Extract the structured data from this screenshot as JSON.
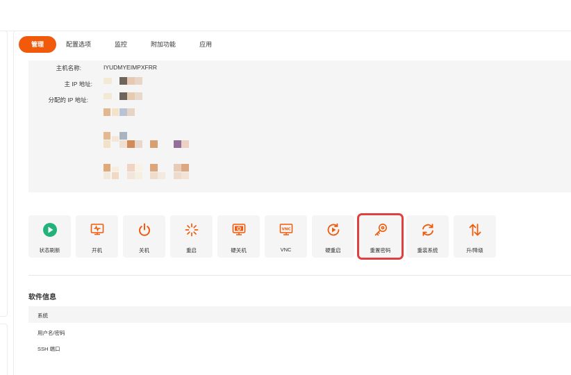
{
  "tabs": [
    {
      "label": "管理",
      "active": true
    },
    {
      "label": "配置选项"
    },
    {
      "label": "监控"
    },
    {
      "label": "附加功能"
    },
    {
      "label": "应用"
    }
  ],
  "info": {
    "hostname_label": "主机名称:",
    "hostname_value": "IYUDMYEIMPXFRR",
    "main_ip_label": "主 IP 地址:",
    "assigned_ip_label": "分配的 IP 地址:"
  },
  "actions": [
    {
      "label": "状态刷新",
      "icon": "play-circle-icon",
      "color": "#23b37a"
    },
    {
      "label": "开机",
      "icon": "power-on-monitor-icon",
      "color": "#f15a0a"
    },
    {
      "label": "关机",
      "icon": "power-icon",
      "color": "#f15a0a"
    },
    {
      "label": "重启",
      "icon": "spinner-icon",
      "color": "#f15a0a"
    },
    {
      "label": "硬关机",
      "icon": "hard-shutdown-icon",
      "color": "#f15a0a"
    },
    {
      "label": "VNC",
      "icon": "vnc-monitor-icon",
      "color": "#f15a0a"
    },
    {
      "label": "硬重启",
      "icon": "hard-restart-icon",
      "color": "#f15a0a"
    },
    {
      "label": "重置密码",
      "icon": "key-icon",
      "color": "#f15a0a",
      "highlighted": true
    },
    {
      "label": "重装系统",
      "icon": "reinstall-icon",
      "color": "#f15a0a"
    },
    {
      "label": "升/降级",
      "icon": "up-down-arrows-icon",
      "color": "#f15a0a"
    }
  ],
  "software": {
    "title": "软件信息",
    "rows": [
      "系统",
      "用户名/密码",
      "SSH 端口"
    ]
  }
}
